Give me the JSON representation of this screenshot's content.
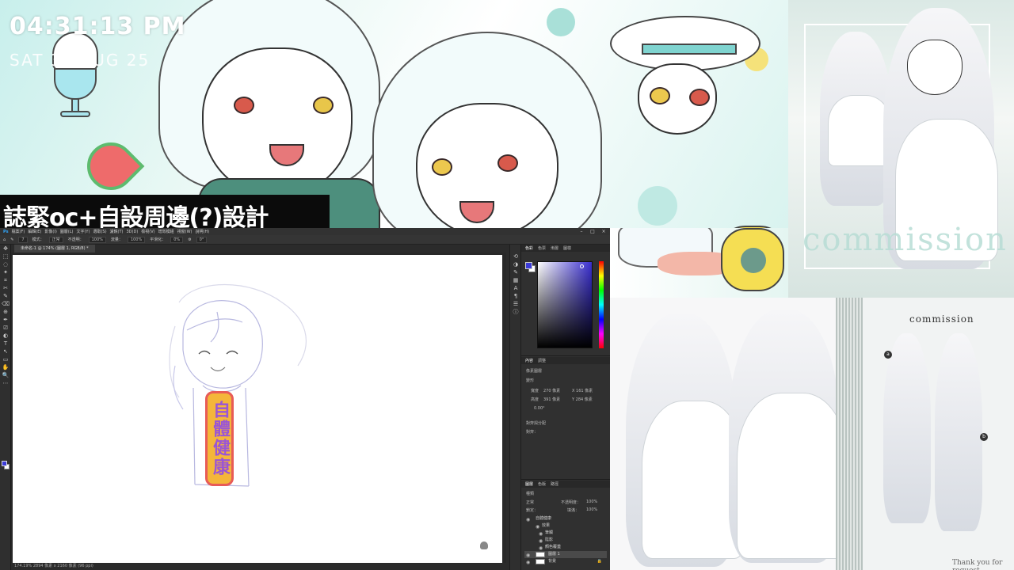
{
  "stream": {
    "clock": "04:31:13 PM",
    "date": "SAT 30 AUG 25",
    "title": "誌緊oc+自設周邊(?)設計",
    "canvas_badge_text": "自體健康"
  },
  "artwork": {
    "top_right_watermark": "commission",
    "bottom_heading": "commission",
    "bottom_markers": [
      "a",
      "b"
    ],
    "bottom_footer": "Thank you for request"
  },
  "photoshop": {
    "menus": [
      "檔案(F)",
      "編輯(E)",
      "影像(I)",
      "圖層(L)",
      "文字(Y)",
      "選取(S)",
      "濾鏡(T)",
      "3D(D)",
      "檢視(V)",
      "增效模組",
      "視窗(W)",
      "說明(H)"
    ],
    "window_controls": [
      "–",
      "□",
      "×"
    ],
    "options": {
      "brush_size": "7",
      "mode_label": "模式：",
      "mode_value": "正常",
      "opacity_label": "不透明：",
      "opacity_value": "100%",
      "flow_label": "流量：",
      "flow_value": "100%",
      "smoothing_label": "平滑化：",
      "smoothing_value": "0%",
      "angle_value": "0°"
    },
    "document_tab": "未命名-1 @ 174% (圖層 1, RGB/8) *",
    "status": "174.19% 2894 像素 x 2160 像素 (96 ppi)",
    "tools": [
      "✥",
      "⬚",
      "◌",
      "✦",
      "⌗",
      "✂",
      "✎",
      "⌫",
      "⊕",
      "✒",
      "⎚",
      "◐",
      "T",
      "↖",
      "▭",
      "✋",
      "🔍",
      "⋯"
    ],
    "color_panel": {
      "tabs": [
        "色彩",
        "色票",
        "漸層",
        "圖樣"
      ],
      "fg": "#3b3bd8",
      "bg": "#ffffff"
    },
    "properties_panel": {
      "tabs": [
        "內容",
        "調整"
      ],
      "heading": "像素圖層",
      "section_transform": "變形",
      "w_label": "寬度",
      "w_value": "270 像素",
      "h_label": "高度",
      "h_value": "391 像素",
      "x_value": "X 161 像素",
      "y_value": "Y 284 像素",
      "angle": "0.00°",
      "section_align": "對齊與分配",
      "align_label": "對齊："
    },
    "layers_panel": {
      "tabs": [
        "圖層",
        "色版",
        "路徑"
      ],
      "filter_label": "種類",
      "blend_mode": "正常",
      "opacity_label": "不透明度：",
      "opacity_value": "100%",
      "lock_label": "鎖定：",
      "fill_label": "填滿：",
      "fill_value": "100%",
      "layers": [
        {
          "name": "自體健康",
          "type": "group",
          "selected": false
        },
        {
          "name": "效果",
          "type": "sub",
          "selected": false
        },
        {
          "name": "筆觸",
          "type": "sub",
          "selected": false
        },
        {
          "name": "陰影",
          "type": "sub",
          "selected": false
        },
        {
          "name": "顏色覆蓋",
          "type": "sub",
          "selected": false
        },
        {
          "name": "圖層 1",
          "type": "pixel",
          "selected": true
        },
        {
          "name": "背景",
          "type": "pixel",
          "selected": false
        }
      ]
    }
  }
}
